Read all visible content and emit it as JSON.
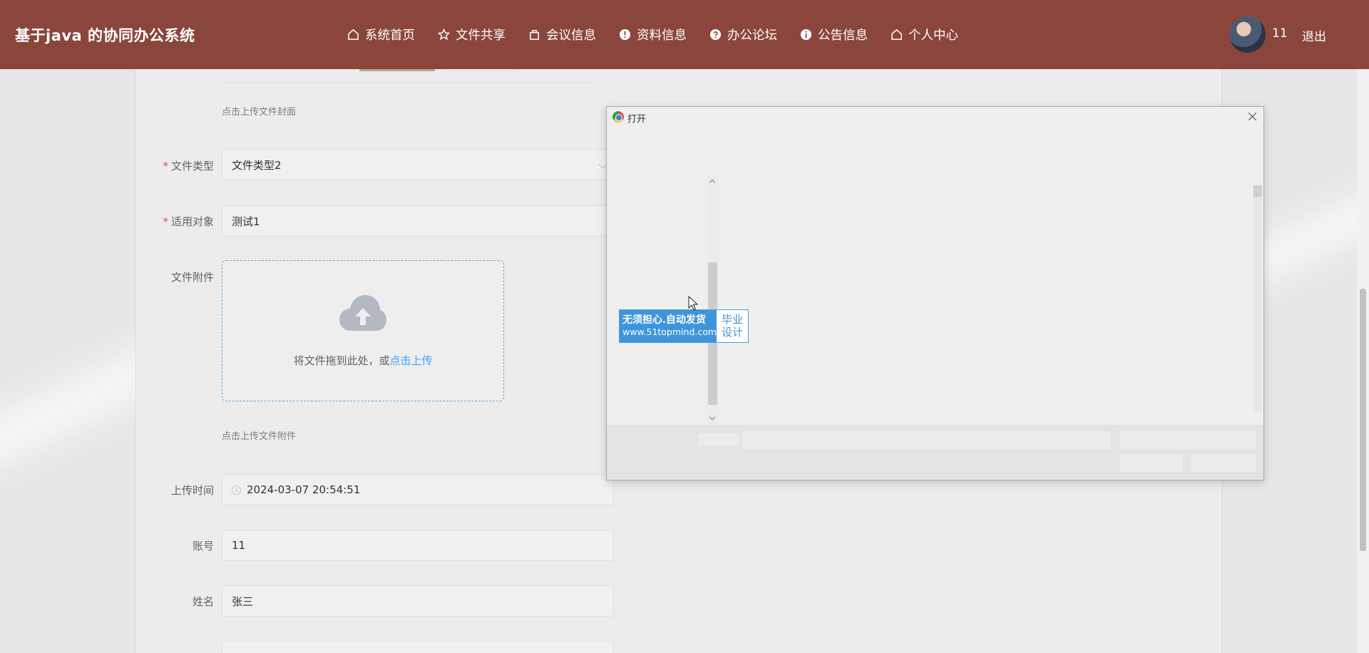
{
  "header": {
    "brand": "基于java 的协同办公系统",
    "nav": [
      {
        "label": "系统首页",
        "icon": "home-icon"
      },
      {
        "label": "文件共享",
        "icon": "star-icon"
      },
      {
        "label": "会议信息",
        "icon": "bag-icon"
      },
      {
        "label": "资料信息",
        "icon": "alert-icon"
      },
      {
        "label": "办公论坛",
        "icon": "question-icon"
      },
      {
        "label": "公告信息",
        "icon": "info-icon"
      },
      {
        "label": "个人中心",
        "icon": "home-icon"
      }
    ],
    "user_id": "11",
    "logout": "退出"
  },
  "form": {
    "cover_hint": "点击上传文件封面",
    "file_type": {
      "label": "文件类型",
      "value": "文件类型2"
    },
    "target": {
      "label": "适用对象",
      "value": "测试1"
    },
    "attachment": {
      "label": "文件附件",
      "drop_text": "将文件拖到此处，或",
      "link_text": "点击上传",
      "hint": "点击上传文件附件"
    },
    "upload_time": {
      "label": "上传时间",
      "value": "2024-03-07 20:54:51"
    },
    "account": {
      "label": "账号",
      "value": "11"
    },
    "name": {
      "label": "姓名",
      "value": "张三"
    }
  },
  "dialog": {
    "title": "打开",
    "ad_line1": "无须担心.自动发货",
    "ad_line2": "www.51topmind.com",
    "ad_right": "毕业设计"
  },
  "colors": {
    "header_bg": "#8a463c",
    "link": "#409eff",
    "required": "#e64a3a"
  }
}
